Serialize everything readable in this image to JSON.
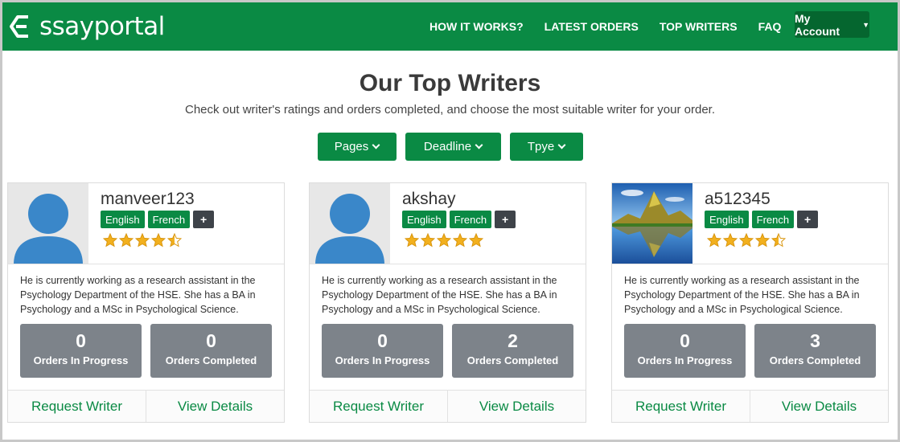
{
  "brand": {
    "logo_text": "ssayportal",
    "logo_letter": "E",
    "accent": "#0a8a44"
  },
  "nav": {
    "links": [
      "HOW IT WORKS?",
      "LATEST ORDERS",
      "TOP WRITERS",
      "FAQ"
    ],
    "account_label": "My Account"
  },
  "hero": {
    "title": "Our Top Writers",
    "subtitle": "Check out writer's ratings and orders completed, and choose the most suitable writer for your order."
  },
  "filters": [
    "Pages",
    "Deadline",
    "Tpye"
  ],
  "writers": [
    {
      "name": "manveer123",
      "avatar": "default-user-icon",
      "languages": [
        "English",
        "French"
      ],
      "more_label": "+",
      "rating": 4.5,
      "description": "He is currently working as a research assistant in the Psychology Department of the HSE. She has a BA in Psychology and a MSc in Psychological Science.",
      "in_progress": "0",
      "in_progress_label": "Orders In Progress",
      "completed": "0",
      "completed_label": "Orders Completed",
      "request_label": "Request Writer",
      "details_label": "View Details"
    },
    {
      "name": "akshay",
      "avatar": "default-user-icon",
      "languages": [
        "English",
        "French"
      ],
      "more_label": "+",
      "rating": 5,
      "description": "He is currently working as a research assistant in the Psychology Department of the HSE. She has a BA in Psychology and a MSc in Psychological Science.",
      "in_progress": "0",
      "in_progress_label": "Orders In Progress",
      "completed": "2",
      "completed_label": "Orders Completed",
      "request_label": "Request Writer",
      "details_label": "View Details"
    },
    {
      "name": "a512345",
      "avatar": "mountain-lake-photo",
      "languages": [
        "English",
        "French"
      ],
      "more_label": "+",
      "rating": 4.5,
      "description": "He is currently working as a research assistant in the Psychology Department of the HSE. She has a BA in Psychology and a MSc in Psychological Science.",
      "in_progress": "0",
      "in_progress_label": "Orders In Progress",
      "completed": "3",
      "completed_label": "Orders Completed",
      "request_label": "Request Writer",
      "details_label": "View Details"
    }
  ]
}
